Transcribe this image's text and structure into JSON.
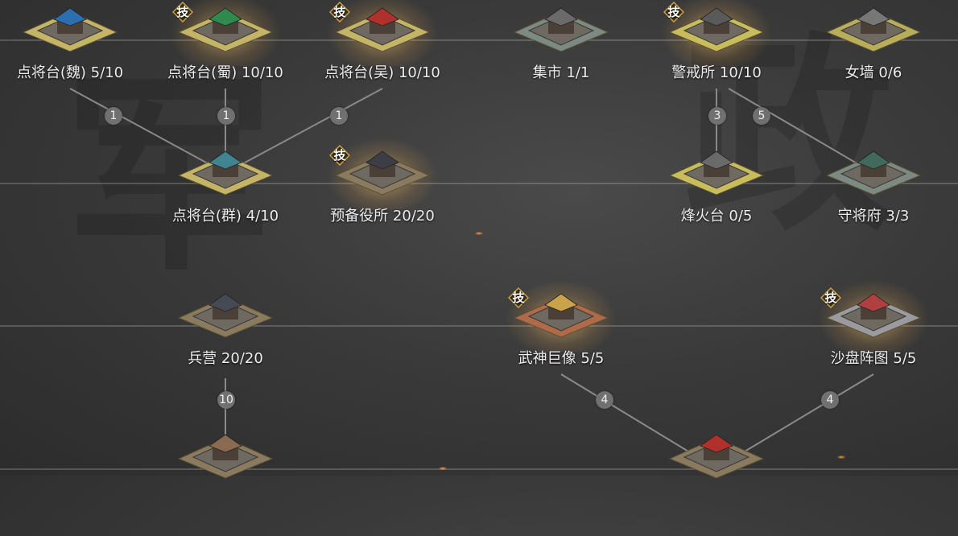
{
  "skill_badge_text": "技",
  "nodes": [
    {
      "id": "dianjiangtai-wei",
      "label": "点将台(魏) 5/10",
      "skill": false,
      "roof": "#2b6fb0",
      "base": "#c4b468"
    },
    {
      "id": "dianjiangtai-shu",
      "label": "点将台(蜀) 10/10",
      "skill": true,
      "roof": "#2f8a4e",
      "base": "#c4b468"
    },
    {
      "id": "dianjiangtai-wu",
      "label": "点将台(吴) 10/10",
      "skill": true,
      "roof": "#b0302b",
      "base": "#c4b468"
    },
    {
      "id": "jishi",
      "label": "集市 1/1",
      "skill": false,
      "roof": "#6a6a6a",
      "base": "#7d8a84"
    },
    {
      "id": "jingjiesuo",
      "label": "警戒所 10/10",
      "skill": true,
      "roof": "#5a5a5a",
      "base": "#c8bc5c"
    },
    {
      "id": "nvqiang",
      "label": "女墙 0/6",
      "skill": false,
      "roof": "#777777",
      "base": "#b8ad5a"
    },
    {
      "id": "dianjiangtai-qun",
      "label": "点将台(群) 4/10",
      "skill": false,
      "roof": "#3f8490",
      "base": "#c4b468"
    },
    {
      "id": "yubeiyisuo",
      "label": "预备役所 20/20",
      "skill": true,
      "roof": "#3d3d45",
      "base": "#8a7b60"
    },
    {
      "id": "fenghuotai",
      "label": "烽火台 0/5",
      "skill": false,
      "roof": "#6a6a6a",
      "base": "#c8bc5c"
    },
    {
      "id": "shoujiangfu",
      "label": "守将府 3/3",
      "skill": false,
      "roof": "#3f6a5c",
      "base": "#7d8a84"
    },
    {
      "id": "bingying",
      "label": "兵营 20/20",
      "skill": false,
      "roof": "#454a55",
      "base": "#8a7b60"
    },
    {
      "id": "wushenjuxiang",
      "label": "武神巨像 5/5",
      "skill": true,
      "roof": "#c9a24a",
      "base": "#b06a4a"
    },
    {
      "id": "shapanzhentu",
      "label": "沙盘阵图 5/5",
      "skill": true,
      "roof": "#b04040",
      "base": "#9a9aa0"
    },
    {
      "id": "bottom-left",
      "label": "",
      "skill": false,
      "roof": "#8a6a50",
      "base": "#8a7b60"
    },
    {
      "id": "bottom-center",
      "label": "",
      "skill": false,
      "roof": "#b0302b",
      "base": "#8a7b60"
    }
  ],
  "link_badges": [
    "1",
    "1",
    "1",
    "3",
    "5",
    "10",
    "4",
    "4"
  ],
  "background_glyphs": [
    "军",
    "政"
  ]
}
